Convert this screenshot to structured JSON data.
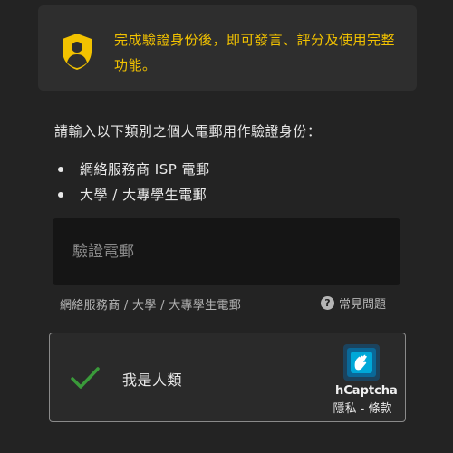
{
  "notice": {
    "text": "完成驗證身份後，即可發言、評分及使用完整功能。",
    "icon": "shield-user-icon",
    "accent": "#f2c200"
  },
  "instruction": "請輸入以下類別之個人電郵用作驗證身份：",
  "bullets": [
    "網絡服務商 ISP 電郵",
    "大學 / 大專學生電郵"
  ],
  "email": {
    "placeholder": "驗證電郵",
    "value": ""
  },
  "hint": "網絡服務商 / 大學 / 大專學生電郵",
  "faq": {
    "icon": "question-circle-icon",
    "label": "常見問題"
  },
  "captcha": {
    "state": "checked",
    "check_color": "#3a9a3a",
    "label": "我是人類",
    "brand": "hCaptcha",
    "privacy": "隱私",
    "separator": " - ",
    "terms": "條款"
  }
}
